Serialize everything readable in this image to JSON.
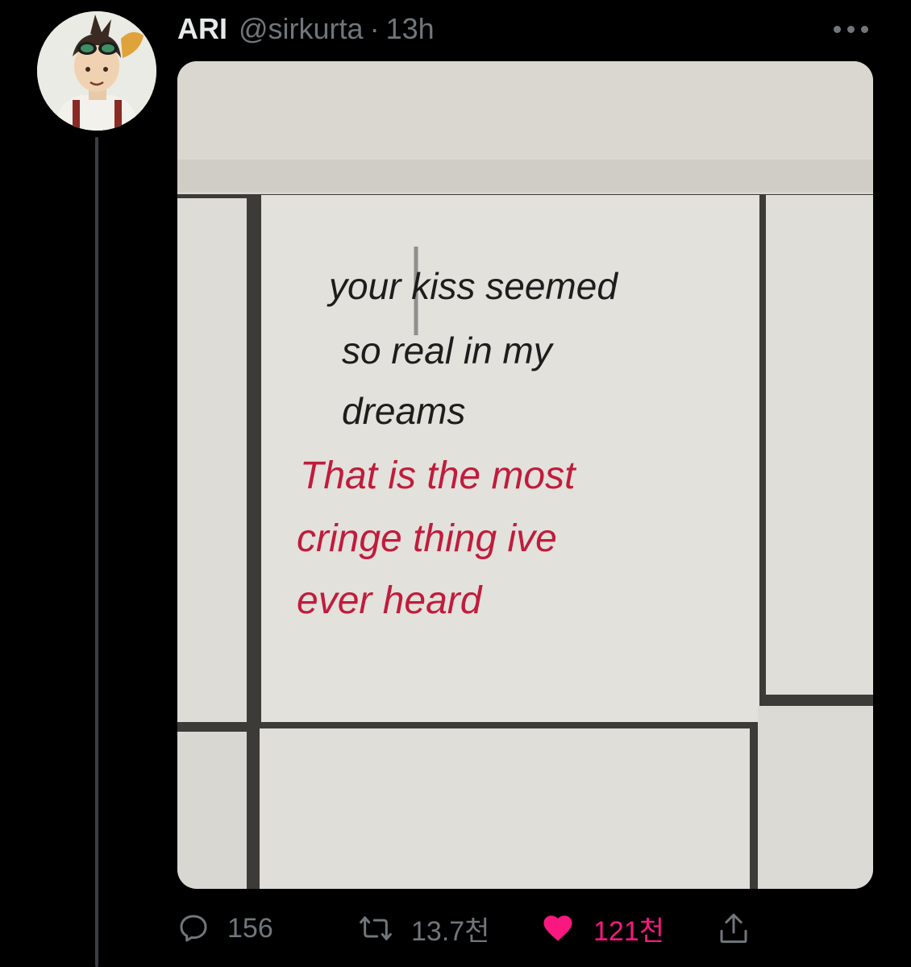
{
  "tweet": {
    "author": {
      "name": "ARI",
      "handle": "@sirkurta",
      "separator": "·",
      "time": "13h"
    },
    "more_icon": "more-dots-icon",
    "media": {
      "tile_text_black": [
        "your kiss seemed",
        "so real in my",
        "dreams"
      ],
      "tile_text_red": [
        "That is the most",
        "cringe thing ive",
        "ever heard"
      ]
    },
    "actions": {
      "reply_count": "156",
      "retweet_count": "13.7천",
      "like_count": "121천",
      "like_color": "#f91880",
      "icons": [
        "reply-icon",
        "retweet-icon",
        "like-icon",
        "share-icon"
      ]
    }
  }
}
